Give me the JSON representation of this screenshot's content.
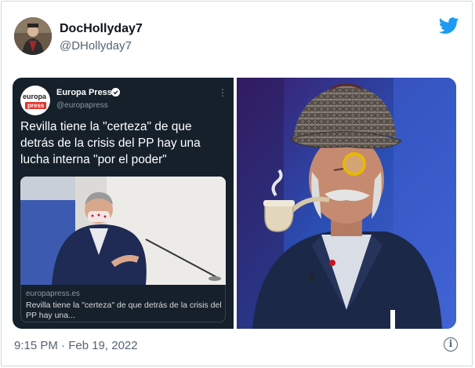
{
  "author": {
    "display_name": "DocHollyday7",
    "handle": "@DHollyday7"
  },
  "icons": {
    "brand": "twitter-bird-icon",
    "info": "info-icon"
  },
  "colors": {
    "twitter_blue": "#1d9bf0",
    "muted_text": "#536471",
    "dark_card": "#15202b",
    "europapress_red": "#e0332b"
  },
  "media": {
    "embedded_tweet": {
      "logo_line1": "europa",
      "logo_line2": "press",
      "name": "Europa Press",
      "handle": "@europapress",
      "text": "Revilla tiene la \"certeza\" de que detrás de la crisis del PP hay una lucha interna \"por el poder\"",
      "link_domain": "europapress.es",
      "link_title": "Revilla tiene la \"certeza\" de que detrás de la crisis del PP hay una..."
    }
  },
  "footer": {
    "timestamp": "9:15 PM · Feb 19, 2022",
    "info_glyph": "i"
  }
}
